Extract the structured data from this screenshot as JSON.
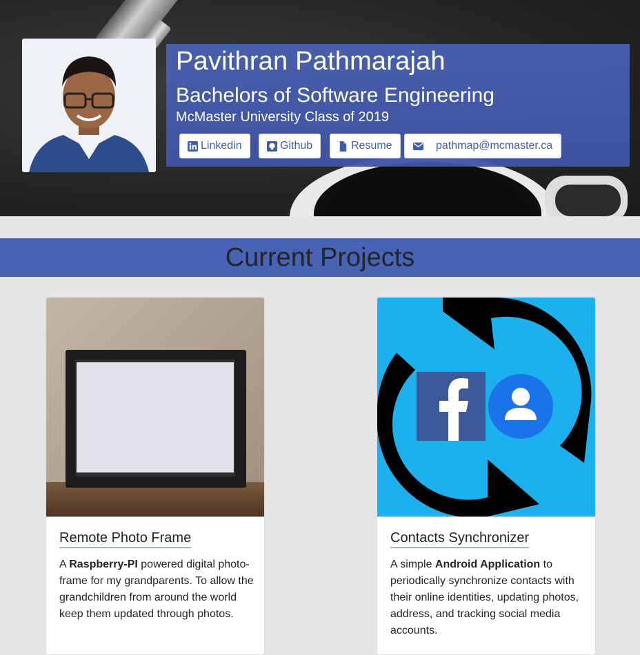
{
  "profile": {
    "name": "Pavithran Pathmarajah",
    "degree": "Bachelors of Software Engineering",
    "school": "McMaster University Class of 2019",
    "links": {
      "linkedin": "Linkedin",
      "github": "Github",
      "resume": "Resume",
      "email": "pathmap@mcmaster.ca"
    }
  },
  "projects": {
    "heading": "Current Projects",
    "items": [
      {
        "title": "Remote Photo Frame",
        "desc_pre": "A ",
        "desc_bold": "Raspberry-PI",
        "desc_post": " powered digital photo-frame for my grandparents. To allow the grandchildren from around the world keep them updated through photos."
      },
      {
        "title": "Contacts Synchronizer",
        "desc_pre": "A simple ",
        "desc_bold": "Android Application",
        "desc_post": " to periodically synchronize contacts with their online identities, updating photos, address, and tracking social media accounts."
      }
    ]
  },
  "colors": {
    "accent": "#4863b3",
    "link": "#3e5cb0",
    "facebook": "#3b5998",
    "contacts": "#1a73e8",
    "sync_bg": "#1db0ef"
  },
  "icons": {
    "linkedin": "linkedin-icon",
    "github": "github-icon",
    "resume": "file-icon",
    "email": "envelope-icon"
  }
}
